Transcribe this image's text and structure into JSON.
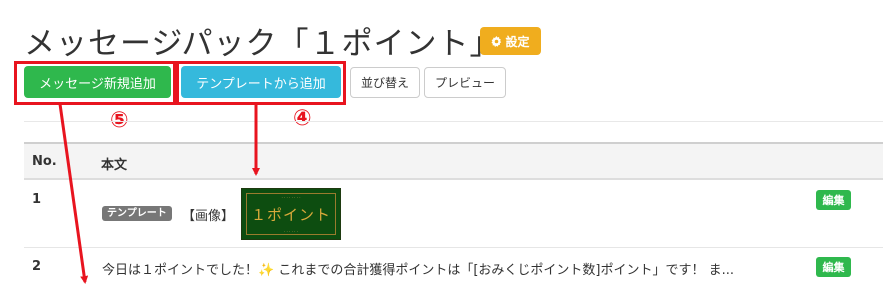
{
  "header": {
    "title": "メッセージパック「１ポイント」",
    "settings_label": "設定",
    "settings_icon": "gear-icon"
  },
  "toolbar": {
    "add_message_label": "メッセージ新規追加",
    "add_from_template_label": "テンプレートから追加",
    "sort_label": "並び替え",
    "preview_label": "プレビュー"
  },
  "annotations": {
    "marker_5": "⑤",
    "marker_4": "④",
    "color": "#e8141f"
  },
  "table": {
    "columns": [
      "No.",
      "本文"
    ],
    "rows": [
      {
        "no": "1",
        "badge": "テンプレート",
        "type_label": "【画像】",
        "thumbnail_text": "１ポイント",
        "edit_label": "編集"
      },
      {
        "no": "2",
        "text": "今日は１ポイントでした！✨ これまでの合計獲得ポイントは「[おみくじポイント数]ポイント」です！ ま...",
        "edit_label": "編集"
      }
    ]
  },
  "colors": {
    "green": "#2fb84d",
    "blue": "#35b9dc",
    "orange": "#f0ad1e",
    "badge_gray": "#777777"
  }
}
